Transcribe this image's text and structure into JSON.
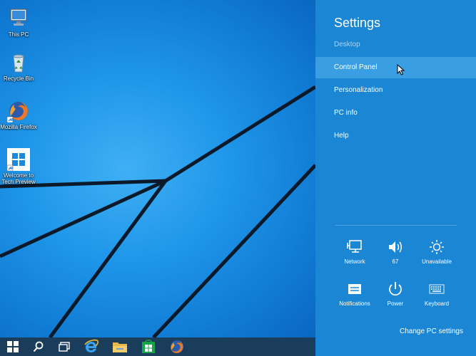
{
  "desktop": {
    "icons": [
      {
        "name": "This PC",
        "icon": "this-pc-icon"
      },
      {
        "name": "Recycle Bin",
        "icon": "recycle-bin-icon"
      },
      {
        "name": "Mozilla Firefox",
        "icon": "firefox-icon"
      },
      {
        "name": "Welcome to Tech Preview",
        "icon": "windows-logo-icon"
      }
    ]
  },
  "taskbar": {
    "items": [
      "start-icon",
      "search-icon",
      "task-view-icon",
      "internet-explorer-icon",
      "file-explorer-icon",
      "store-icon",
      "firefox-icon"
    ]
  },
  "settings": {
    "title": "Settings",
    "subtitle": "Desktop",
    "menu": [
      {
        "label": "Control Panel",
        "hovered": true
      },
      {
        "label": "Personalization"
      },
      {
        "label": "PC info"
      },
      {
        "label": "Help"
      }
    ],
    "quick": [
      {
        "label": "Network",
        "icon": "network-icon"
      },
      {
        "label": "67",
        "icon": "volume-icon"
      },
      {
        "label": "Unavailable",
        "icon": "brightness-icon"
      },
      {
        "label": "Notifications",
        "icon": "notifications-icon"
      },
      {
        "label": "Power",
        "icon": "power-icon"
      },
      {
        "label": "Keyboard",
        "icon": "keyboard-icon"
      }
    ],
    "change_link": "Change PC settings"
  },
  "colors": {
    "panel_bg": "#1a86d4",
    "hover_bg": "#3a9ee2",
    "taskbar_bg": "#1a3d5c"
  }
}
